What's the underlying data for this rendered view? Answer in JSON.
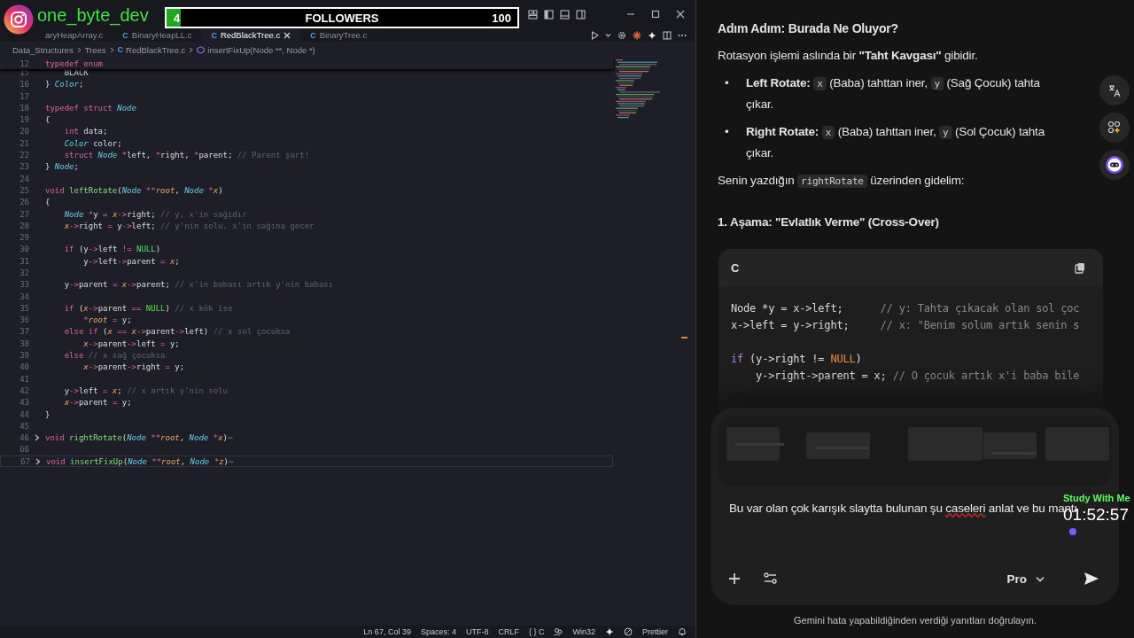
{
  "overlay": {
    "channel": {
      "handle": "one_byte_dev"
    },
    "followers": {
      "count": "4",
      "label": "FOLLOWERS",
      "goal": "100",
      "level": 0.04
    },
    "timer": {
      "label": "Study With Me",
      "time": "01:52:57"
    }
  },
  "editor": {
    "tabs": [
      {
        "label": "aryHeapArray.c",
        "selected": false
      },
      {
        "badge": "C",
        "label": "BinaryHeapLL.c",
        "selected": false
      },
      {
        "badge": "C",
        "label": "RedBlackTree.c",
        "selected": true
      },
      {
        "badge": "C",
        "label": "BinaryTree.c",
        "selected": false
      }
    ],
    "breadcrumbs": [
      {
        "kind": "folder",
        "text": "Data_Structures"
      },
      {
        "kind": "folder",
        "text": "Trees"
      },
      {
        "kind": "file",
        "badge": "C",
        "text": "RedBlackTree.c"
      },
      {
        "kind": "symbol",
        "text": "insertFixUp(Node **, Node *)"
      }
    ],
    "sticky_line": {
      "number": "12",
      "tokens": [
        {
          "kind": "keyword",
          "text": "typedef enum"
        }
      ]
    },
    "lines": [
      {
        "number": "15",
        "folded": false,
        "current": false,
        "tokens": [
          {
            "kind": "plain",
            "text": "    BLACK"
          }
        ]
      },
      {
        "number": "16",
        "folded": false,
        "current": false,
        "tokens": [
          {
            "kind": "plain",
            "text": "} "
          },
          {
            "kind": "type",
            "text": "Color"
          },
          {
            "kind": "plain",
            "text": ";"
          }
        ]
      },
      {
        "number": "17",
        "folded": false,
        "current": false
      },
      {
        "number": "18",
        "folded": false,
        "current": false,
        "tokens": [
          {
            "kind": "keyword",
            "text": "typedef struct "
          },
          {
            "kind": "type",
            "text": "Node"
          }
        ]
      },
      {
        "number": "19",
        "folded": false,
        "current": false,
        "tokens": [
          {
            "kind": "plain",
            "text": "{"
          }
        ]
      },
      {
        "number": "20",
        "folded": false,
        "current": false,
        "tokens": [
          {
            "kind": "keyword",
            "text": "    int"
          },
          {
            "kind": "plain",
            "text": " data;"
          }
        ]
      },
      {
        "number": "21",
        "folded": false,
        "current": false,
        "tokens": [
          {
            "kind": "type",
            "text": "    Color"
          },
          {
            "kind": "plain",
            "text": " color;"
          }
        ]
      },
      {
        "number": "22",
        "folded": false,
        "current": false,
        "tokens": [
          {
            "kind": "keyword",
            "text": "    struct "
          },
          {
            "kind": "type",
            "text": "Node"
          },
          {
            "kind": "operator",
            "text": " *"
          },
          {
            "kind": "plain",
            "text": "left, "
          },
          {
            "kind": "operator",
            "text": "*"
          },
          {
            "kind": "plain",
            "text": "right, "
          },
          {
            "kind": "operator",
            "text": "*"
          },
          {
            "kind": "plain",
            "text": "parent; "
          },
          {
            "kind": "comment",
            "text": "// Parent şart!"
          }
        ]
      },
      {
        "number": "23",
        "folded": false,
        "current": false,
        "tokens": [
          {
            "kind": "plain",
            "text": "} "
          },
          {
            "kind": "type",
            "text": "Node"
          },
          {
            "kind": "plain",
            "text": ";"
          }
        ]
      },
      {
        "number": "24",
        "folded": false,
        "current": false
      },
      {
        "number": "25",
        "folded": false,
        "current": false,
        "tokens": [
          {
            "kind": "keyword",
            "text": "void "
          },
          {
            "kind": "function",
            "text": "leftRotate"
          },
          {
            "kind": "plain",
            "text": "("
          },
          {
            "kind": "type",
            "text": "Node"
          },
          {
            "kind": "operator",
            "text": " **"
          },
          {
            "kind": "param",
            "text": "root"
          },
          {
            "kind": "plain",
            "text": ", "
          },
          {
            "kind": "type",
            "text": "Node"
          },
          {
            "kind": "operator",
            "text": " *"
          },
          {
            "kind": "param",
            "text": "x"
          },
          {
            "kind": "plain",
            "text": ")"
          }
        ]
      },
      {
        "number": "26",
        "folded": false,
        "current": false,
        "tokens": [
          {
            "kind": "plain",
            "text": "{"
          }
        ]
      },
      {
        "number": "27",
        "folded": false,
        "current": false,
        "tokens": [
          {
            "kind": "type",
            "text": "    Node"
          },
          {
            "kind": "operator",
            "text": " *"
          },
          {
            "kind": "plain",
            "text": "y "
          },
          {
            "kind": "operator",
            "text": "="
          },
          {
            "kind": "param",
            "text": " x"
          },
          {
            "kind": "operator",
            "text": "->"
          },
          {
            "kind": "plain",
            "text": "right; "
          },
          {
            "kind": "comment",
            "text": "// y, x'in sağıdır"
          }
        ]
      },
      {
        "number": "28",
        "folded": false,
        "current": false,
        "tokens": [
          {
            "kind": "param",
            "text": "    x"
          },
          {
            "kind": "operator",
            "text": "->"
          },
          {
            "kind": "plain",
            "text": "right "
          },
          {
            "kind": "operator",
            "text": "="
          },
          {
            "kind": "plain",
            "text": " y"
          },
          {
            "kind": "operator",
            "text": "->"
          },
          {
            "kind": "plain",
            "text": "left; "
          },
          {
            "kind": "comment",
            "text": "// y'nin solu, x'in sağına gecer"
          }
        ]
      },
      {
        "number": "29",
        "folded": false,
        "current": false
      },
      {
        "number": "30",
        "folded": false,
        "current": false,
        "tokens": [
          {
            "kind": "keyword",
            "text": "    if "
          },
          {
            "kind": "plain",
            "text": "(y"
          },
          {
            "kind": "operator",
            "text": "->"
          },
          {
            "kind": "plain",
            "text": "left "
          },
          {
            "kind": "operator",
            "text": "!="
          },
          {
            "kind": "constant",
            "text": " NULL"
          },
          {
            "kind": "plain",
            "text": ")"
          }
        ]
      },
      {
        "number": "31",
        "folded": false,
        "current": false,
        "tokens": [
          {
            "kind": "plain",
            "text": "        y"
          },
          {
            "kind": "operator",
            "text": "->"
          },
          {
            "kind": "plain",
            "text": "left"
          },
          {
            "kind": "operator",
            "text": "->"
          },
          {
            "kind": "plain",
            "text": "parent "
          },
          {
            "kind": "operator",
            "text": "="
          },
          {
            "kind": "param",
            "text": " x"
          },
          {
            "kind": "plain",
            "text": ";"
          }
        ]
      },
      {
        "number": "32",
        "folded": false,
        "current": false
      },
      {
        "number": "33",
        "folded": false,
        "current": false,
        "tokens": [
          {
            "kind": "plain",
            "text": "    y"
          },
          {
            "kind": "operator",
            "text": "->"
          },
          {
            "kind": "plain",
            "text": "parent "
          },
          {
            "kind": "operator",
            "text": "="
          },
          {
            "kind": "param",
            "text": " x"
          },
          {
            "kind": "operator",
            "text": "->"
          },
          {
            "kind": "plain",
            "text": "parent; "
          },
          {
            "kind": "comment",
            "text": "// x'in babası artık y'nin babası"
          }
        ]
      },
      {
        "number": "34",
        "folded": false,
        "current": false
      },
      {
        "number": "35",
        "folded": false,
        "current": false,
        "tokens": [
          {
            "kind": "keyword",
            "text": "    if "
          },
          {
            "kind": "plain",
            "text": "("
          },
          {
            "kind": "param",
            "text": "x"
          },
          {
            "kind": "operator",
            "text": "->"
          },
          {
            "kind": "plain",
            "text": "parent "
          },
          {
            "kind": "operator",
            "text": "=="
          },
          {
            "kind": "constant",
            "text": " NULL"
          },
          {
            "kind": "plain",
            "text": ") "
          },
          {
            "kind": "comment",
            "text": "// x kök ise"
          }
        ]
      },
      {
        "number": "36",
        "folded": false,
        "current": false,
        "tokens": [
          {
            "kind": "operator",
            "text": "        *"
          },
          {
            "kind": "param",
            "text": "root "
          },
          {
            "kind": "operator",
            "text": "="
          },
          {
            "kind": "plain",
            "text": " y;"
          }
        ]
      },
      {
        "number": "37",
        "folded": false,
        "current": false,
        "tokens": [
          {
            "kind": "keyword",
            "text": "    else if "
          },
          {
            "kind": "plain",
            "text": "("
          },
          {
            "kind": "param",
            "text": "x"
          },
          {
            "kind": "operator",
            "text": " == "
          },
          {
            "kind": "param",
            "text": "x"
          },
          {
            "kind": "operator",
            "text": "->"
          },
          {
            "kind": "plain",
            "text": "parent"
          },
          {
            "kind": "operator",
            "text": "->"
          },
          {
            "kind": "plain",
            "text": "left) "
          },
          {
            "kind": "comment",
            "text": "// x sol çocuksa"
          }
        ]
      },
      {
        "number": "38",
        "folded": false,
        "current": false,
        "tokens": [
          {
            "kind": "param",
            "text": "        x"
          },
          {
            "kind": "operator",
            "text": "->"
          },
          {
            "kind": "plain",
            "text": "parent"
          },
          {
            "kind": "operator",
            "text": "->"
          },
          {
            "kind": "plain",
            "text": "left "
          },
          {
            "kind": "operator",
            "text": "="
          },
          {
            "kind": "plain",
            "text": " y;"
          }
        ]
      },
      {
        "number": "39",
        "folded": false,
        "current": false,
        "tokens": [
          {
            "kind": "keyword",
            "text": "    else "
          },
          {
            "kind": "comment",
            "text": "// x sağ çocuksa"
          }
        ]
      },
      {
        "number": "40",
        "folded": false,
        "current": false,
        "tokens": [
          {
            "kind": "param",
            "text": "        x"
          },
          {
            "kind": "operator",
            "text": "->"
          },
          {
            "kind": "plain",
            "text": "parent"
          },
          {
            "kind": "operator",
            "text": "->"
          },
          {
            "kind": "plain",
            "text": "right "
          },
          {
            "kind": "operator",
            "text": "="
          },
          {
            "kind": "plain",
            "text": " y;"
          }
        ]
      },
      {
        "number": "41",
        "folded": false,
        "current": false
      },
      {
        "number": "42",
        "folded": false,
        "current": false,
        "tokens": [
          {
            "kind": "plain",
            "text": "    y"
          },
          {
            "kind": "operator",
            "text": "->"
          },
          {
            "kind": "plain",
            "text": "left "
          },
          {
            "kind": "operator",
            "text": "="
          },
          {
            "kind": "param",
            "text": " x"
          },
          {
            "kind": "plain",
            "text": "; "
          },
          {
            "kind": "comment",
            "text": "// x artık y'nin solu"
          }
        ]
      },
      {
        "number": "43",
        "folded": false,
        "current": false,
        "tokens": [
          {
            "kind": "param",
            "text": "    x"
          },
          {
            "kind": "operator",
            "text": "->"
          },
          {
            "kind": "plain",
            "text": "parent "
          },
          {
            "kind": "operator",
            "text": "="
          },
          {
            "kind": "plain",
            "text": " y;"
          }
        ]
      },
      {
        "number": "44",
        "folded": false,
        "current": false,
        "tokens": [
          {
            "kind": "plain",
            "text": "}"
          }
        ]
      },
      {
        "number": "45",
        "folded": false,
        "current": false
      },
      {
        "number": "46",
        "folded": true,
        "current": false,
        "tokens": [
          {
            "kind": "keyword",
            "text": "void "
          },
          {
            "kind": "function",
            "text": "rightRotate"
          },
          {
            "kind": "plain",
            "text": "("
          },
          {
            "kind": "type",
            "text": "Node"
          },
          {
            "kind": "operator",
            "text": " **"
          },
          {
            "kind": "param",
            "text": "root"
          },
          {
            "kind": "plain",
            "text": ", "
          },
          {
            "kind": "type",
            "text": "Node"
          },
          {
            "kind": "operator",
            "text": " *"
          },
          {
            "kind": "param",
            "text": "x"
          },
          {
            "kind": "plain",
            "text": ")"
          },
          {
            "kind": "fold",
            "text": "⋯"
          }
        ]
      },
      {
        "number": "66",
        "folded": false,
        "current": false
      },
      {
        "number": "67",
        "folded": true,
        "current": true,
        "tokens": [
          {
            "kind": "keyword",
            "text": "void "
          },
          {
            "kind": "function",
            "text": "insertFixUp"
          },
          {
            "kind": "plain",
            "text": "("
          },
          {
            "kind": "type",
            "text": "Node"
          },
          {
            "kind": "operator",
            "text": " **"
          },
          {
            "kind": "param",
            "text": "root"
          },
          {
            "kind": "plain",
            "text": ", "
          },
          {
            "kind": "type",
            "text": "Node"
          },
          {
            "kind": "operator",
            "text": " *"
          },
          {
            "kind": "param",
            "text": "z"
          },
          {
            "kind": "plain",
            "text": ")"
          },
          {
            "kind": "fold",
            "text": "⋯"
          }
        ]
      }
    ],
    "status_bar": [
      {
        "kind": "text",
        "text": "Ln 67, Col 39"
      },
      {
        "kind": "text",
        "text": "Spaces: 4"
      },
      {
        "kind": "text",
        "text": "UTF-8"
      },
      {
        "kind": "text",
        "text": "CRLF"
      },
      {
        "kind": "text",
        "text": "{ } C"
      },
      {
        "kind": "icon"
      },
      {
        "kind": "text",
        "text": "Win32"
      },
      {
        "kind": "icon"
      },
      {
        "kind": "icon"
      },
      {
        "kind": "text",
        "text": "Prettier"
      },
      {
        "kind": "icon"
      }
    ]
  },
  "chat": {
    "heading": "Adım Adım: Burada Ne Oluyor?",
    "intro": "Rotasyon işlemi aslında bir **\"Taht Kavgası\"** gibidir.",
    "bullets": [
      {
        "marker": "•",
        "parts": [
          {
            "kind": "bold",
            "text": "Left Rotate: "
          },
          {
            "kind": "code",
            "text": "x"
          },
          {
            "kind": "text",
            "text": " (Baba) tahttan iner, "
          },
          {
            "kind": "code",
            "text": "y"
          },
          {
            "kind": "text",
            "text": " (Sağ Çocuk) tahta çıkar."
          }
        ]
      },
      {
        "marker": "•",
        "parts": [
          {
            "kind": "bold",
            "text": "Right Rotate: "
          },
          {
            "kind": "code",
            "text": "x"
          },
          {
            "kind": "text",
            "text": " (Baba) tahttan iner, "
          },
          {
            "kind": "code",
            "text": "y"
          },
          {
            "kind": "text",
            "text": " (Sol Çocuk) tahta çıkar."
          }
        ]
      }
    ],
    "lead": [
      {
        "kind": "text",
        "text": "Senin yazdığın "
      },
      {
        "kind": "code",
        "text": "rightRotate"
      },
      {
        "kind": "text",
        "text": " üzerinden gidelim:"
      }
    ],
    "step_heading": "1. Aşama: \"Evlatlık Verme\" (Cross-Over)",
    "code_block": {
      "language": "C",
      "lines": [
        {
          "kind": "code",
          "tokens": [
            {
              "kind": "plain",
              "text": "Node *y = x->left;      "
            },
            {
              "kind": "comment",
              "text": "// y: Tahta çıkacak olan sol çoc"
            }
          ]
        },
        {
          "kind": "code",
          "tokens": [
            {
              "kind": "plain",
              "text": "x->left = y->right;     "
            },
            {
              "kind": "comment",
              "text": "// x: \"Benim solum artık senin s"
            }
          ]
        },
        {
          "kind": "blank"
        },
        {
          "kind": "code",
          "tokens": [
            {
              "kind": "keyword",
              "text": "if"
            },
            {
              "kind": "plain",
              "text": " (y->right != "
            },
            {
              "kind": "constant",
              "text": "NULL"
            },
            {
              "kind": "plain",
              "text": ")"
            }
          ]
        },
        {
          "kind": "code",
          "tokens": [
            {
              "kind": "plain",
              "text": "    y->right->parent = x; "
            },
            {
              "kind": "comment",
              "text": "// O çocuk artık x'i baba bile"
            }
          ]
        }
      ]
    },
    "composer": {
      "prompt": [
        {
          "text": "Bu var olan çok karışık slaytta bulunan şu ",
          "misspelled": false
        },
        {
          "text": "caseleri",
          "misspelled": true
        },
        {
          "text": " anlat ve bu mantı",
          "misspelled": false
        }
      ],
      "model": "Pro"
    },
    "disclaimer": "Gemini hata yapabildiğinden verdiği yanıtları doğrulayın."
  }
}
